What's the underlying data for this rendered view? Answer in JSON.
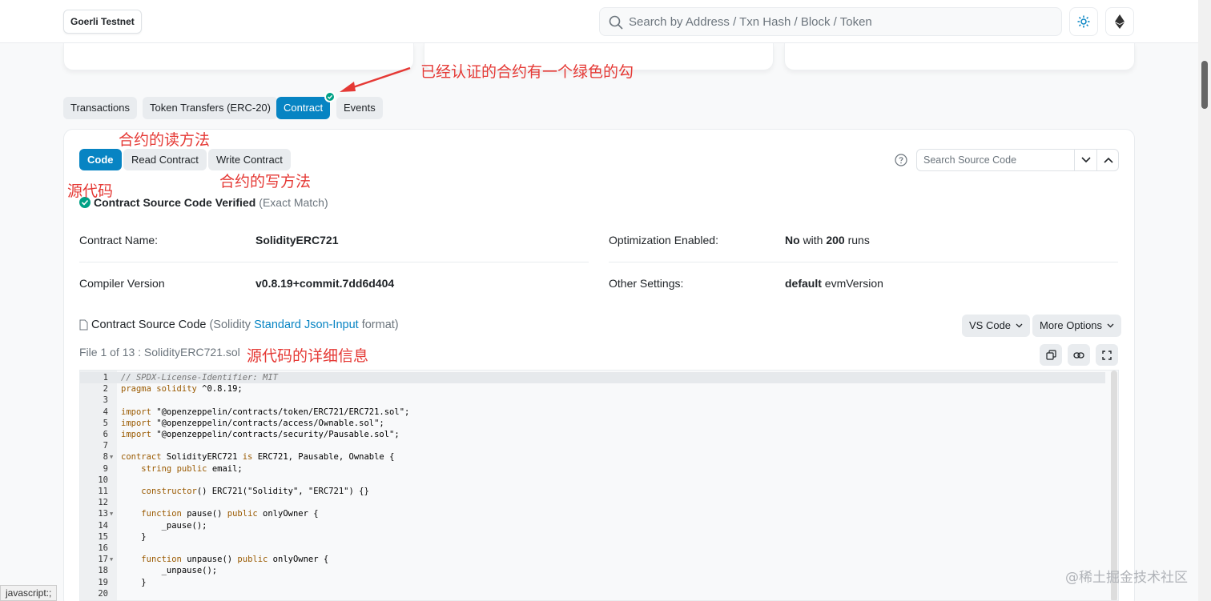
{
  "header": {
    "network": "Goerli Testnet",
    "search_placeholder": "Search by Address / Txn Hash / Block / Token",
    "theme_icon": "sun-icon",
    "network_icon": "ethereum-icon"
  },
  "tabs": [
    {
      "label": "Transactions"
    },
    {
      "label": "Token Transfers (ERC-20)"
    },
    {
      "label": "Contract",
      "active": true,
      "verified": true
    },
    {
      "label": "Events"
    }
  ],
  "contract": {
    "subtabs": [
      {
        "label": "Code",
        "active": true
      },
      {
        "label": "Read Contract"
      },
      {
        "label": "Write Contract"
      }
    ],
    "search_placeholder": "Search Source Code",
    "verified_title": "Contract Source Code Verified",
    "verified_note": "(Exact Match)",
    "info": {
      "name_label": "Contract Name:",
      "name_value": "SolidityERC721",
      "compiler_label": "Compiler Version",
      "compiler_value": "v0.8.19+commit.7dd6d404",
      "optimization_label": "Optimization Enabled:",
      "optimization_value": "No",
      "optimization_with": "with",
      "optimization_runs": "200",
      "optimization_suffix": "runs",
      "other_label": "Other Settings:",
      "other_value": "default",
      "other_suffix": "evmVersion"
    },
    "source": {
      "title": "Contract Source Code",
      "format_prefix": "(Solidity",
      "format_link": "Standard Json-Input",
      "format_suffix": "format)",
      "vscode_label": "VS Code",
      "more_label": "More Options",
      "file_info": "File 1 of 13 : SolidityERC721.sol"
    }
  },
  "code_lines": [
    {
      "n": "1",
      "text": "// SPDX-License-Identifier: MIT",
      "kind": "comment"
    },
    {
      "n": "2",
      "text": "pragma solidity ^0.8.19;"
    },
    {
      "n": "3",
      "text": ""
    },
    {
      "n": "4",
      "text": "import \"@openzeppelin/contracts/token/ERC721/ERC721.sol\";"
    },
    {
      "n": "5",
      "text": "import \"@openzeppelin/contracts/access/Ownable.sol\";"
    },
    {
      "n": "6",
      "text": "import \"@openzeppelin/contracts/security/Pausable.sol\";"
    },
    {
      "n": "7",
      "text": ""
    },
    {
      "n": "8",
      "text": "contract SolidityERC721 is ERC721, Pausable, Ownable {",
      "fold": true
    },
    {
      "n": "9",
      "text": "    string public email;"
    },
    {
      "n": "10",
      "text": ""
    },
    {
      "n": "11",
      "text": "    constructor() ERC721(\"Solidity\", \"ERC721\") {}"
    },
    {
      "n": "12",
      "text": ""
    },
    {
      "n": "13",
      "text": "    function pause() public onlyOwner {",
      "fold": true
    },
    {
      "n": "14",
      "text": "        _pause();"
    },
    {
      "n": "15",
      "text": "    }"
    },
    {
      "n": "16",
      "text": ""
    },
    {
      "n": "17",
      "text": "    function unpause() public onlyOwner {",
      "fold": true
    },
    {
      "n": "18",
      "text": "        _unpause();"
    },
    {
      "n": "19",
      "text": "    }"
    },
    {
      "n": "20",
      "text": ""
    }
  ],
  "annotations": {
    "verified_tab": "已经认证的合约有一个绿色的勾",
    "read_method": "合约的读方法",
    "write_method": "合约的写方法",
    "source_code": "源代码",
    "source_detail": "源代码的详细信息"
  },
  "status_tip": "javascript:;",
  "watermark": "@稀土掘金技术社区",
  "colors": {
    "accent": "#0784c3",
    "verified": "#00a186",
    "annotation": "#e53935"
  }
}
